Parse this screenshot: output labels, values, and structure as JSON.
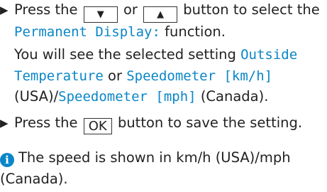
{
  "colors": {
    "accent": "#0a86c8",
    "text": "#222222",
    "key_border": "#333333"
  },
  "step1": {
    "bullet_icon": "triangle-right",
    "prefix": "Press the",
    "key_down": "▼",
    "or_text": "or",
    "key_up": "▲",
    "after_keys": "button to select the",
    "function_name": "Permanent Display:",
    "function_suffix": "function.",
    "result_prefix": "You will see the selected setting",
    "setting_outside_line1": "Outside",
    "setting_outside_line2": "Temperature",
    "or_text2": "or",
    "setting_speedo_kmh": "Speedometer [km/h]",
    "usa_label": "(USA)/",
    "setting_speedo_mph": "Speedometer [mph]",
    "canada_label": "(Canada)."
  },
  "step2": {
    "bullet_icon": "triangle-right",
    "prefix": "Press the",
    "key_ok": "OK",
    "suffix": "button to save the setting."
  },
  "note": {
    "icon": "info-icon",
    "line1": "The speed is shown in km/h (USA)/mph",
    "line2": "(Canada)."
  }
}
